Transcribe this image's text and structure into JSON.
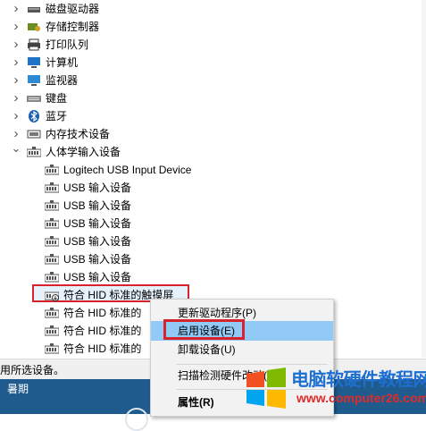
{
  "tree": {
    "items": [
      {
        "label": "磁盘驱动器",
        "icon": "disk-drive-icon",
        "level": 0,
        "expander": "collapsed"
      },
      {
        "label": "存储控制器",
        "icon": "storage-controller-icon",
        "level": 0,
        "expander": "collapsed"
      },
      {
        "label": "打印队列",
        "icon": "printer-icon",
        "level": 0,
        "expander": "collapsed"
      },
      {
        "label": "计算机",
        "icon": "computer-icon",
        "level": 0,
        "expander": "collapsed"
      },
      {
        "label": "监视器",
        "icon": "monitor-icon",
        "level": 0,
        "expander": "collapsed"
      },
      {
        "label": "键盘",
        "icon": "keyboard-icon",
        "level": 0,
        "expander": "collapsed"
      },
      {
        "label": "蓝牙",
        "icon": "bluetooth-icon",
        "level": 0,
        "expander": "collapsed"
      },
      {
        "label": "内存技术设备",
        "icon": "memory-device-icon",
        "level": 0,
        "expander": "collapsed"
      },
      {
        "label": "人体学输入设备",
        "icon": "hid-device-icon",
        "level": 0,
        "expander": "expanded"
      },
      {
        "label": "Logitech USB Input Device",
        "icon": "hid-device-icon",
        "level": 1
      },
      {
        "label": "USB 输入设备",
        "icon": "hid-device-icon",
        "level": 1
      },
      {
        "label": "USB 输入设备",
        "icon": "hid-device-icon",
        "level": 1
      },
      {
        "label": "USB 输入设备",
        "icon": "hid-device-icon",
        "level": 1
      },
      {
        "label": "USB 输入设备",
        "icon": "hid-device-icon",
        "level": 1
      },
      {
        "label": "USB 输入设备",
        "icon": "hid-device-icon",
        "level": 1
      },
      {
        "label": "USB 输入设备",
        "icon": "hid-device-icon",
        "level": 1
      },
      {
        "label": "符合 HID 标准的触摸屏",
        "icon": "hid-disabled-icon",
        "level": 1,
        "selected": true
      },
      {
        "label": "符合 HID 标准的",
        "icon": "hid-device-icon",
        "level": 1
      },
      {
        "label": "符合 HID 标准的",
        "icon": "hid-device-icon",
        "level": 1
      },
      {
        "label": "符合 HID 标准的",
        "icon": "hid-device-icon",
        "level": 1
      }
    ]
  },
  "context_menu": {
    "items": [
      {
        "label": "更新驱动程序(P)",
        "highlighted": false,
        "bold": false
      },
      {
        "label": "启用设备(E)",
        "highlighted": true,
        "bold": false
      },
      {
        "label": "卸载设备(U)",
        "highlighted": false,
        "bold": false
      },
      {
        "label": "扫描检测硬件改动(A)",
        "highlighted": false,
        "bold": false
      },
      {
        "label": "属性(R)",
        "highlighted": false,
        "bold": true
      }
    ]
  },
  "statusbar": {
    "text": "用所选设备。"
  },
  "taskbar": {
    "text": "暑期"
  },
  "watermark": {
    "title": "电脑软硬件教程网",
    "url": "www.computer26.com"
  },
  "colors": {
    "highlight": "#91c9f7",
    "annotation": "#d9232c",
    "selection": "#e5f1fb",
    "watermark_blue": "#1d6fd1",
    "watermark_red": "#e02b2b"
  }
}
